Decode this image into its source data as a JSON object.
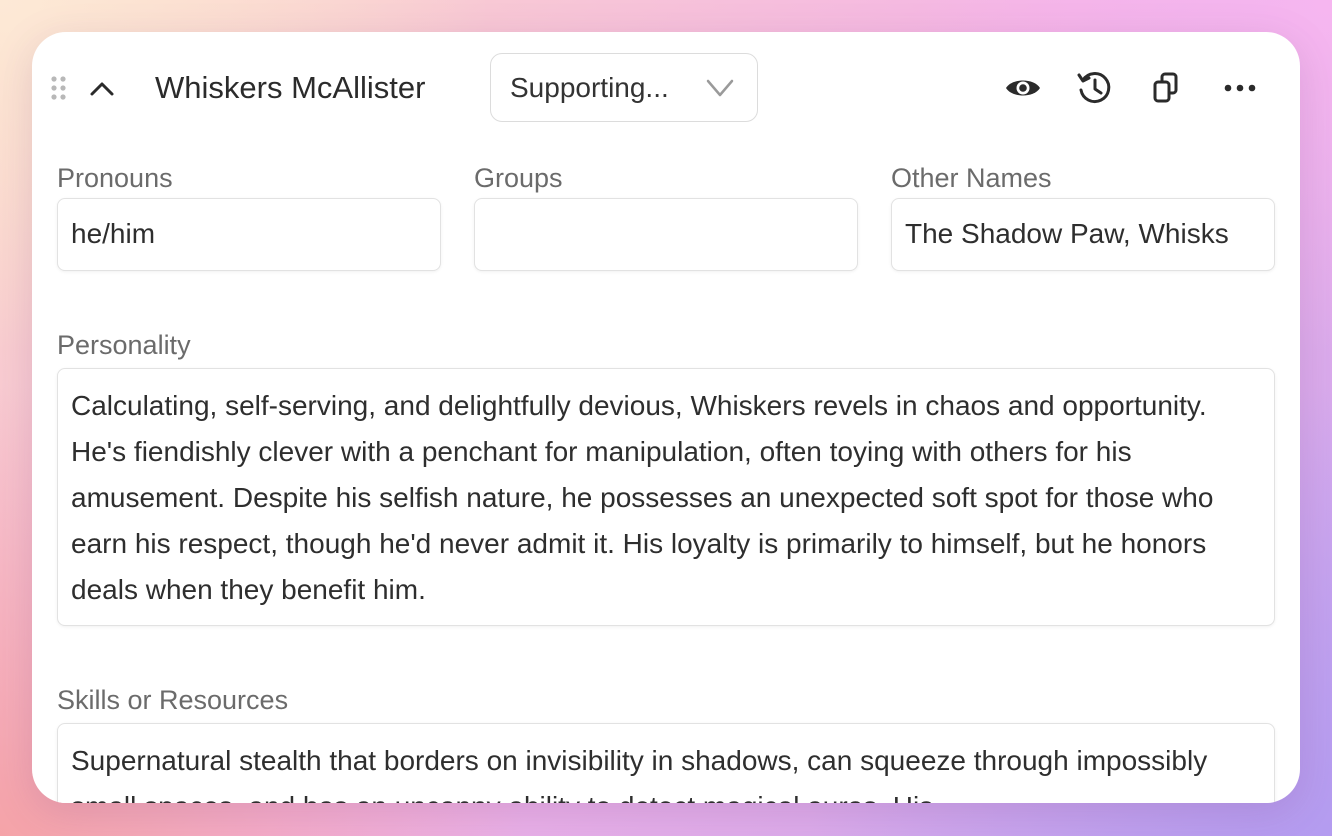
{
  "character": {
    "name": "Whiskers McAllister",
    "role": "Supporting..."
  },
  "toolbar": {
    "icons": [
      "eye-icon",
      "history-icon",
      "copy-icon",
      "more-icon"
    ]
  },
  "fields": {
    "pronouns": {
      "label": "Pronouns",
      "value": "he/him"
    },
    "groups": {
      "label": "Groups",
      "value": ""
    },
    "other_names": {
      "label": "Other Names",
      "value": "The Shadow Paw, Whisks"
    },
    "personality": {
      "label": "Personality",
      "value": "Calculating, self-serving, and delightfully devious, Whiskers revels in chaos and opportunity. He's fiendishly clever with a penchant for manipulation, often toying with others for his amusement. Despite his selfish nature, he possesses an unexpected soft spot for those who earn his respect, though he'd never admit it. His loyalty is primarily to himself, but he honors deals when they benefit him."
    },
    "skills": {
      "label": "Skills or Resources",
      "value": "Supernatural stealth that borders on invisibility in shadows, can squeeze through impossibly small spaces, and has an uncanny ability to detect magical auras. His"
    }
  },
  "colors": {
    "text": "#2e2e2e",
    "label": "#6b6b6b",
    "border": "#e2e2e2"
  }
}
